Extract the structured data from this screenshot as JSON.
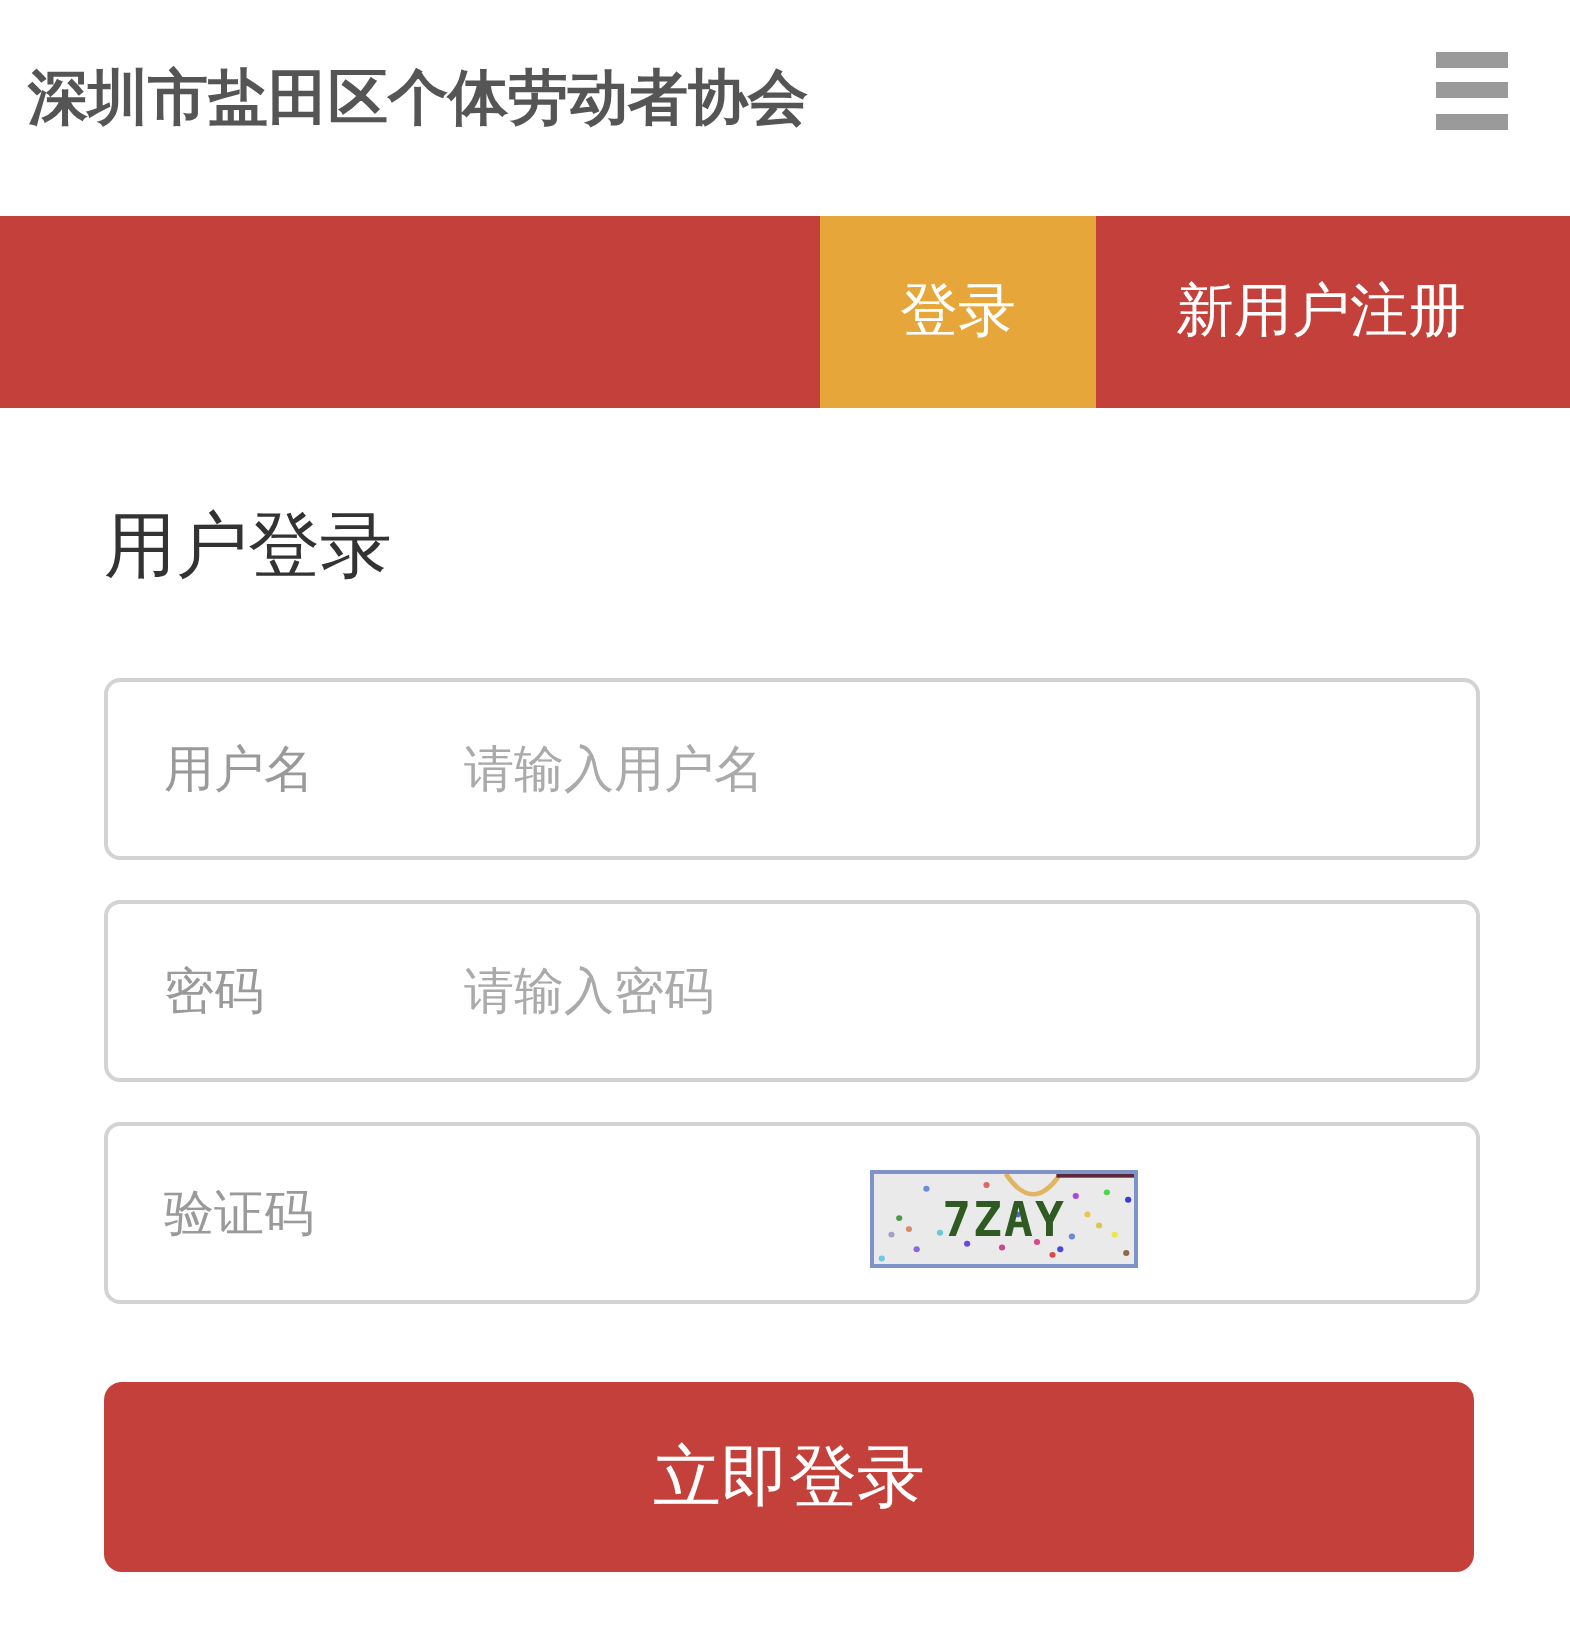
{
  "header": {
    "title": "深圳市盐田区个体劳动者协会"
  },
  "nav": {
    "tabs": [
      {
        "label": "登录",
        "selected": true
      },
      {
        "label": "新用户注册",
        "selected": false
      }
    ]
  },
  "form": {
    "heading": "用户登录",
    "fields": [
      {
        "kind": "text",
        "label": "用户名",
        "placeholder": "请输入用户名"
      },
      {
        "kind": "password",
        "label": "密码",
        "placeholder": "请输入密码"
      },
      {
        "kind": "captcha",
        "label": "验证码",
        "captcha_text": "7ZAY"
      }
    ],
    "submit": "立即登录"
  }
}
